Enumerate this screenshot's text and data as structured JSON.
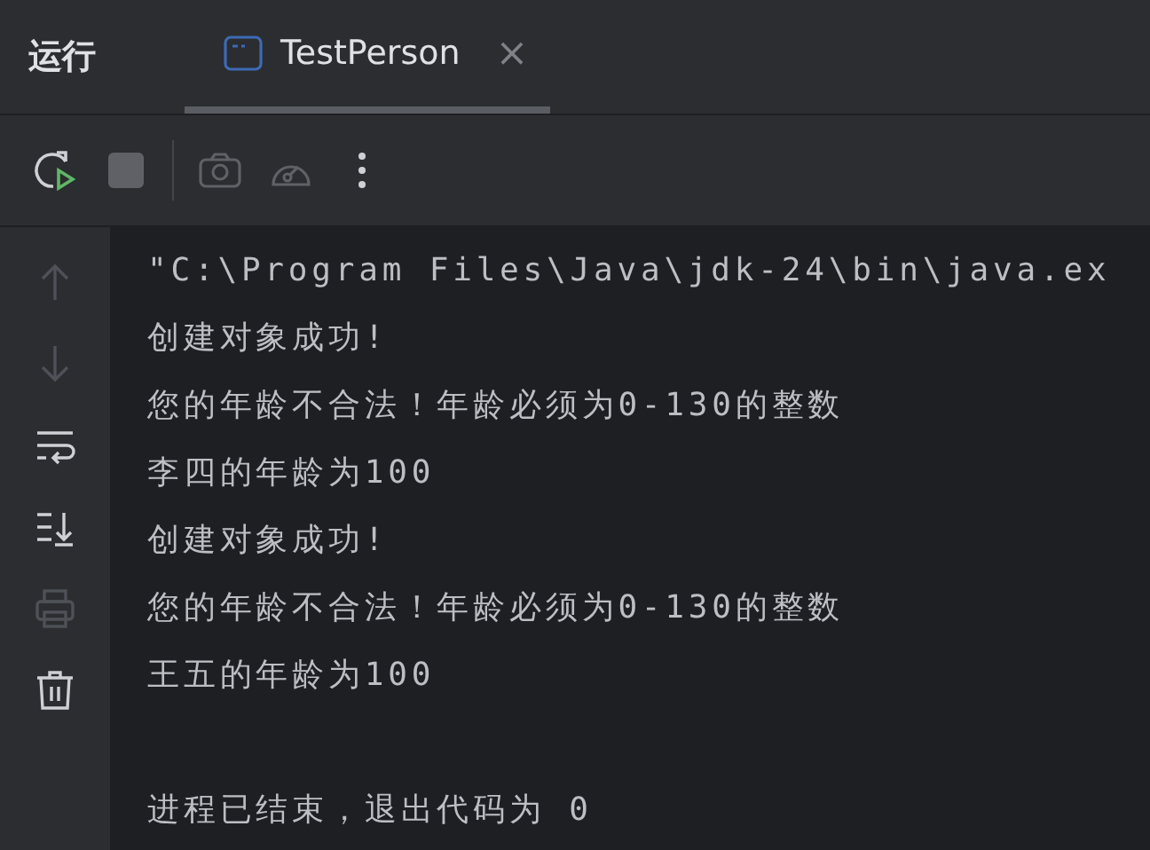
{
  "panel": {
    "title": "运行"
  },
  "tabs": [
    {
      "label": "TestPerson",
      "selected": true,
      "close": "×"
    }
  ],
  "toolbar": [
    {
      "buttons": [
        {
          "kind": "rerun",
          "disabled": false
        },
        {
          "kind": "stop",
          "disabled": true
        }
      ]
    },
    {
      "buttons": [
        {
          "kind": "camera",
          "disabled": true
        },
        {
          "kind": "gauge",
          "disabled": true
        },
        {
          "kind": "more",
          "disabled": false
        }
      ]
    }
  ],
  "sidebar": [
    {
      "kind": "up",
      "disabled": true
    },
    {
      "kind": "down",
      "disabled": true
    },
    {
      "kind": "wrap",
      "disabled": false
    },
    {
      "kind": "scroll-end",
      "disabled": false
    },
    {
      "kind": "print",
      "disabled": true
    },
    {
      "kind": "trash",
      "disabled": false
    }
  ],
  "console": {
    "lines": [
      "\"C:\\Program Files\\Java\\jdk-24\\bin\\java.ex",
      "创建对象成功!",
      "您的年龄不合法！年龄必须为0-130的整数",
      "李四的年龄为100",
      "创建对象成功!",
      "您的年龄不合法！年龄必须为0-130的整数",
      "王五的年龄为100"
    ],
    "exit_message": "进程已结束，退出代码为 0"
  }
}
